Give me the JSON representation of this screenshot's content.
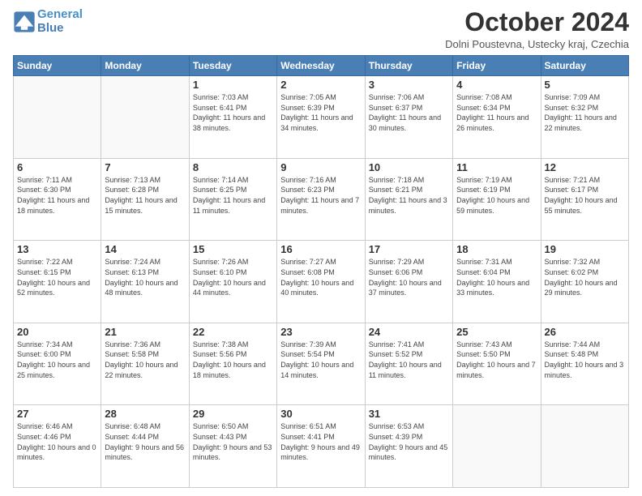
{
  "header": {
    "logo_line1": "General",
    "logo_line2": "Blue",
    "title": "October 2024",
    "subtitle": "Dolni Poustevna, Ustecky kraj, Czechia"
  },
  "days_of_week": [
    "Sunday",
    "Monday",
    "Tuesday",
    "Wednesday",
    "Thursday",
    "Friday",
    "Saturday"
  ],
  "weeks": [
    [
      {
        "day": "",
        "info": ""
      },
      {
        "day": "",
        "info": ""
      },
      {
        "day": "1",
        "info": "Sunrise: 7:03 AM\nSunset: 6:41 PM\nDaylight: 11 hours and 38 minutes."
      },
      {
        "day": "2",
        "info": "Sunrise: 7:05 AM\nSunset: 6:39 PM\nDaylight: 11 hours and 34 minutes."
      },
      {
        "day": "3",
        "info": "Sunrise: 7:06 AM\nSunset: 6:37 PM\nDaylight: 11 hours and 30 minutes."
      },
      {
        "day": "4",
        "info": "Sunrise: 7:08 AM\nSunset: 6:34 PM\nDaylight: 11 hours and 26 minutes."
      },
      {
        "day": "5",
        "info": "Sunrise: 7:09 AM\nSunset: 6:32 PM\nDaylight: 11 hours and 22 minutes."
      }
    ],
    [
      {
        "day": "6",
        "info": "Sunrise: 7:11 AM\nSunset: 6:30 PM\nDaylight: 11 hours and 18 minutes."
      },
      {
        "day": "7",
        "info": "Sunrise: 7:13 AM\nSunset: 6:28 PM\nDaylight: 11 hours and 15 minutes."
      },
      {
        "day": "8",
        "info": "Sunrise: 7:14 AM\nSunset: 6:25 PM\nDaylight: 11 hours and 11 minutes."
      },
      {
        "day": "9",
        "info": "Sunrise: 7:16 AM\nSunset: 6:23 PM\nDaylight: 11 hours and 7 minutes."
      },
      {
        "day": "10",
        "info": "Sunrise: 7:18 AM\nSunset: 6:21 PM\nDaylight: 11 hours and 3 minutes."
      },
      {
        "day": "11",
        "info": "Sunrise: 7:19 AM\nSunset: 6:19 PM\nDaylight: 10 hours and 59 minutes."
      },
      {
        "day": "12",
        "info": "Sunrise: 7:21 AM\nSunset: 6:17 PM\nDaylight: 10 hours and 55 minutes."
      }
    ],
    [
      {
        "day": "13",
        "info": "Sunrise: 7:22 AM\nSunset: 6:15 PM\nDaylight: 10 hours and 52 minutes."
      },
      {
        "day": "14",
        "info": "Sunrise: 7:24 AM\nSunset: 6:13 PM\nDaylight: 10 hours and 48 minutes."
      },
      {
        "day": "15",
        "info": "Sunrise: 7:26 AM\nSunset: 6:10 PM\nDaylight: 10 hours and 44 minutes."
      },
      {
        "day": "16",
        "info": "Sunrise: 7:27 AM\nSunset: 6:08 PM\nDaylight: 10 hours and 40 minutes."
      },
      {
        "day": "17",
        "info": "Sunrise: 7:29 AM\nSunset: 6:06 PM\nDaylight: 10 hours and 37 minutes."
      },
      {
        "day": "18",
        "info": "Sunrise: 7:31 AM\nSunset: 6:04 PM\nDaylight: 10 hours and 33 minutes."
      },
      {
        "day": "19",
        "info": "Sunrise: 7:32 AM\nSunset: 6:02 PM\nDaylight: 10 hours and 29 minutes."
      }
    ],
    [
      {
        "day": "20",
        "info": "Sunrise: 7:34 AM\nSunset: 6:00 PM\nDaylight: 10 hours and 25 minutes."
      },
      {
        "day": "21",
        "info": "Sunrise: 7:36 AM\nSunset: 5:58 PM\nDaylight: 10 hours and 22 minutes."
      },
      {
        "day": "22",
        "info": "Sunrise: 7:38 AM\nSunset: 5:56 PM\nDaylight: 10 hours and 18 minutes."
      },
      {
        "day": "23",
        "info": "Sunrise: 7:39 AM\nSunset: 5:54 PM\nDaylight: 10 hours and 14 minutes."
      },
      {
        "day": "24",
        "info": "Sunrise: 7:41 AM\nSunset: 5:52 PM\nDaylight: 10 hours and 11 minutes."
      },
      {
        "day": "25",
        "info": "Sunrise: 7:43 AM\nSunset: 5:50 PM\nDaylight: 10 hours and 7 minutes."
      },
      {
        "day": "26",
        "info": "Sunrise: 7:44 AM\nSunset: 5:48 PM\nDaylight: 10 hours and 3 minutes."
      }
    ],
    [
      {
        "day": "27",
        "info": "Sunrise: 6:46 AM\nSunset: 4:46 PM\nDaylight: 10 hours and 0 minutes."
      },
      {
        "day": "28",
        "info": "Sunrise: 6:48 AM\nSunset: 4:44 PM\nDaylight: 9 hours and 56 minutes."
      },
      {
        "day": "29",
        "info": "Sunrise: 6:50 AM\nSunset: 4:43 PM\nDaylight: 9 hours and 53 minutes."
      },
      {
        "day": "30",
        "info": "Sunrise: 6:51 AM\nSunset: 4:41 PM\nDaylight: 9 hours and 49 minutes."
      },
      {
        "day": "31",
        "info": "Sunrise: 6:53 AM\nSunset: 4:39 PM\nDaylight: 9 hours and 45 minutes."
      },
      {
        "day": "",
        "info": ""
      },
      {
        "day": "",
        "info": ""
      }
    ]
  ]
}
